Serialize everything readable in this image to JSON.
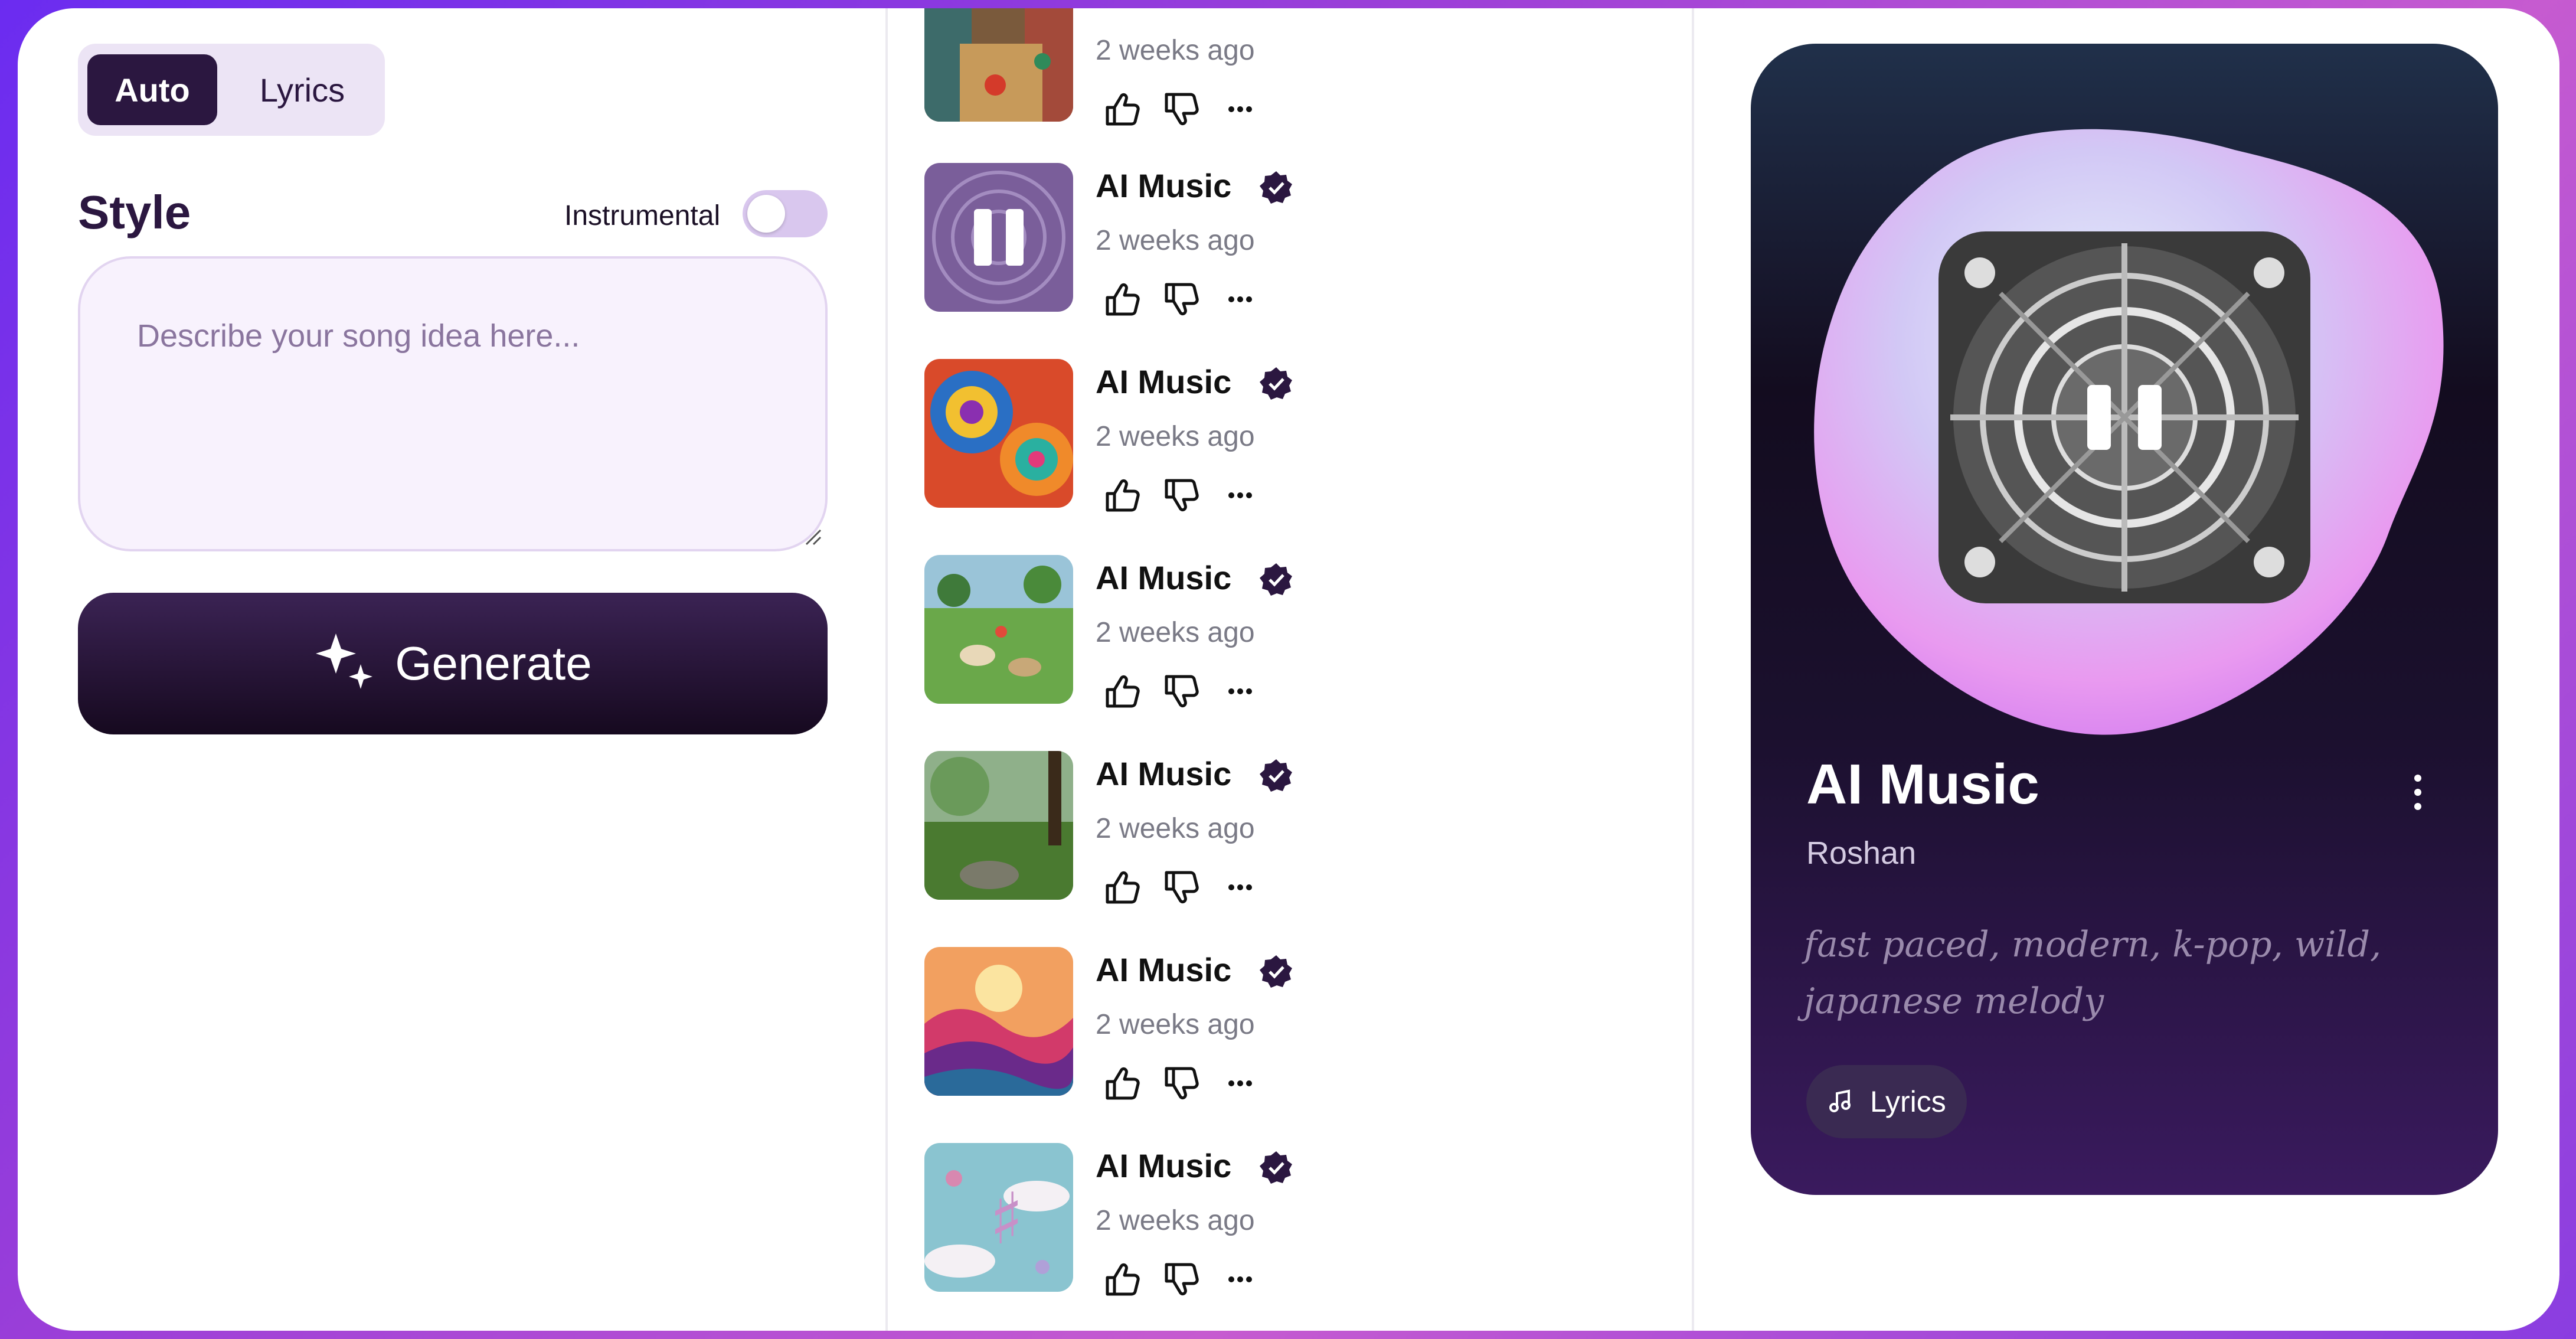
{
  "mode_toggle": {
    "auto": "Auto",
    "lyrics": "Lyrics",
    "selected": "Auto"
  },
  "style": {
    "title": "Style",
    "instrumental_label": "Instrumental",
    "instrumental_on": false
  },
  "prompt": {
    "placeholder": "Describe your song idea here...",
    "value": ""
  },
  "generate": {
    "label": "Generate",
    "icon": "sparkles-icon"
  },
  "songs": [
    {
      "title": "",
      "time": "2 weeks ago",
      "art": "street-scene"
    },
    {
      "title": "AI Music",
      "time": "2 weeks ago",
      "art": "purple-mandala",
      "playing": true
    },
    {
      "title": "AI Music",
      "time": "2 weeks ago",
      "art": "psychedelic-swirls"
    },
    {
      "title": "AI Music",
      "time": "2 weeks ago",
      "art": "animals-meadow"
    },
    {
      "title": "AI Music",
      "time": "2 weeks ago",
      "art": "misty-forest"
    },
    {
      "title": "AI Music",
      "time": "2 weeks ago",
      "art": "sunset-mountains"
    },
    {
      "title": "AI Music",
      "time": "2 weeks ago",
      "art": "music-notes-clouds"
    }
  ],
  "player": {
    "title": "AI Music",
    "artist": "Roshan",
    "tags": "fast paced, modern, k-pop, wild, japanese melody",
    "lyrics_button": "Lyrics",
    "state": "playing"
  },
  "colors": {
    "accent_dark": "#2b1740",
    "toggle_bg": "#ece4f5",
    "input_bg": "#f8f2fd"
  }
}
